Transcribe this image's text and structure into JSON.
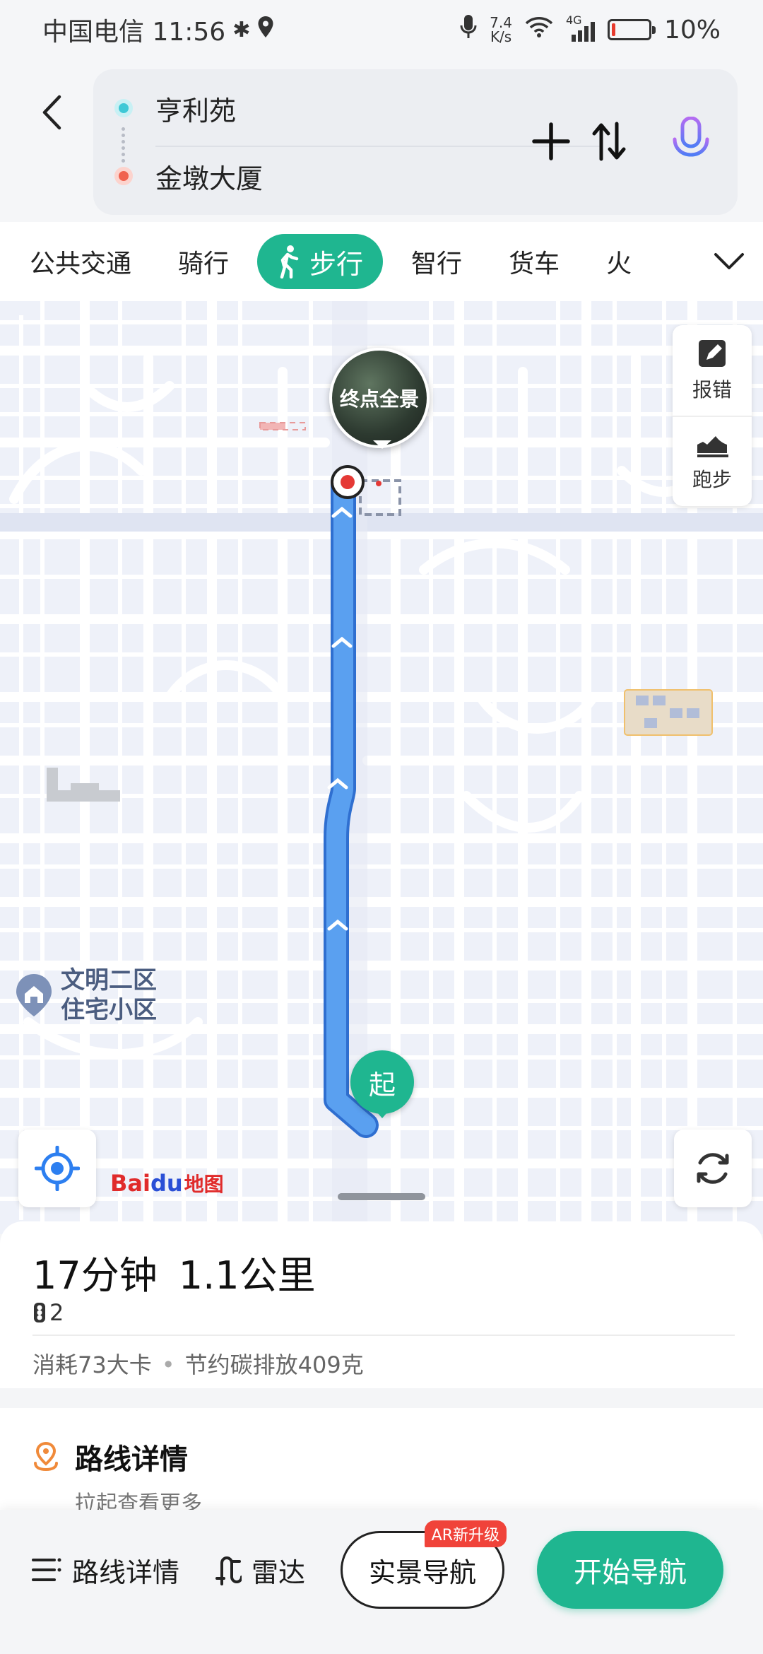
{
  "status_bar": {
    "carrier_time": "中国电信 11:56",
    "net_speed_value": "7.4",
    "net_speed_unit": "K/s",
    "network_type": "4G",
    "battery_percent": "10%",
    "battery_level": 0.1
  },
  "route": {
    "origin": "亨利苑",
    "destination": "金墩大厦"
  },
  "modes": {
    "tabs": [
      "公共交通",
      "骑行",
      "步行",
      "智行",
      "货车",
      "火"
    ],
    "active": "步行"
  },
  "map": {
    "tools": {
      "report": "报错",
      "run": "跑步"
    },
    "pano_label": "终点全景",
    "start_label": "起",
    "poi_name_line1": "文明二区",
    "poi_name_line2": "住宅小区",
    "logo": {
      "bai": "Bai",
      "du": "du",
      "map": "地图"
    }
  },
  "summary": {
    "time": "17分钟",
    "distance": "1.1公里",
    "traffic_lights": "2",
    "calories": "消耗73大卡",
    "carbon": "节约碳排放409克"
  },
  "details": {
    "title": "路线详情",
    "subtitle": "拉起查看更多"
  },
  "actions": {
    "route_details": "路线详情",
    "radar": "雷达",
    "ar_nav": "实景导航",
    "ar_badge": "AR新升级",
    "start_nav": "开始导航"
  },
  "colors": {
    "accent": "#1fb690",
    "route_line": "#4a90e8",
    "origin_dot": "#3ec8d6",
    "destination_dot": "#f0624f"
  }
}
